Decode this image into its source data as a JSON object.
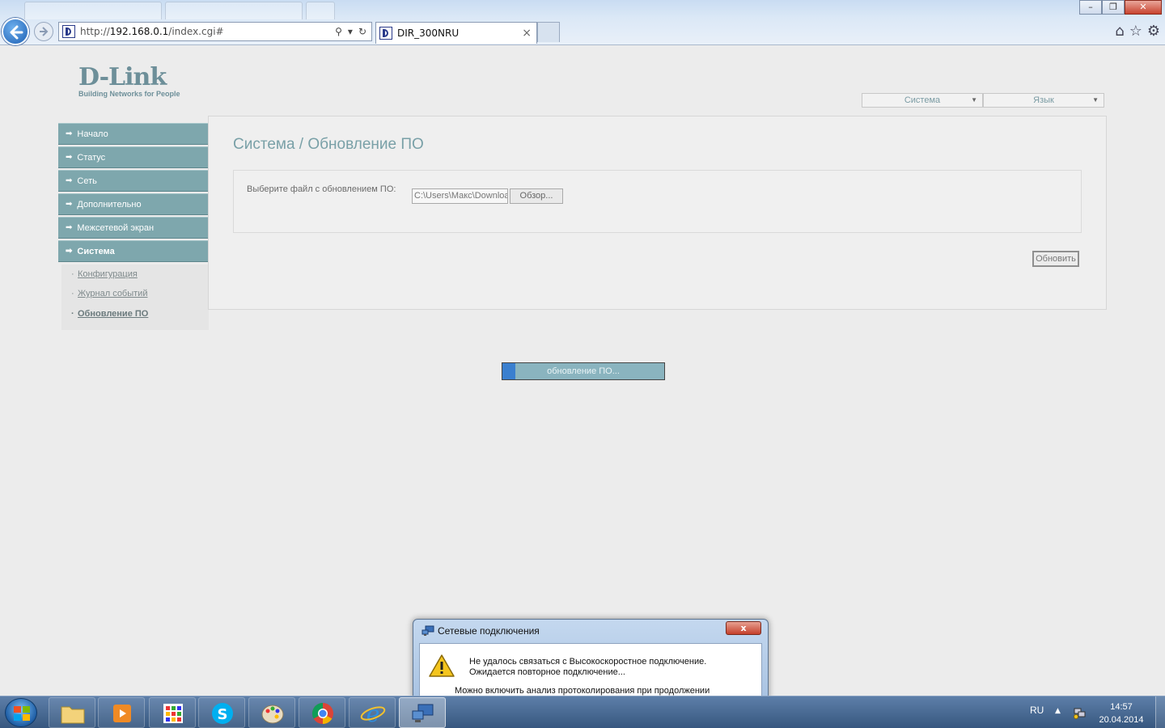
{
  "browser": {
    "url_prefix": "http://",
    "url_host": "192.168.0.1",
    "url_path": "/index.cgi#",
    "tab_title": "DIR_300NRU"
  },
  "logo": {
    "brand": "D-Link",
    "tagline": "Building Networks for People"
  },
  "top_menu": {
    "system": "Система",
    "language": "Язык"
  },
  "sidebar": {
    "items": [
      {
        "label": "Начало"
      },
      {
        "label": "Статус"
      },
      {
        "label": "Сеть"
      },
      {
        "label": "Дополнительно"
      },
      {
        "label": "Межсетевой экран"
      },
      {
        "label": "Система"
      }
    ],
    "sub_items": [
      {
        "label": "Конфигурация"
      },
      {
        "label": "Журнал событий"
      },
      {
        "label": "Обновление ПО"
      }
    ]
  },
  "main": {
    "title": "Система / Обновление ПО",
    "file_label": "Выберите файл с обновлением ПО:",
    "file_value": "C:\\Users\\Макс\\Downloa",
    "browse_label": "Обзор...",
    "update_label": "Обновить"
  },
  "progress": {
    "text": "обновление ПО...",
    "fraction": 0.08
  },
  "dialog": {
    "title": "Сетевые подключения",
    "close_label": "x",
    "message_line1": "Не удалось связаться с Высокоскоростное подключение.",
    "message_line2": "Ожидается повторное подключение...",
    "hint": "Можно включить анализ протоколирования при продолжении"
  },
  "taskbar": {
    "language": "RU",
    "time": "14:57",
    "date": "20.04.2014"
  },
  "colors": {
    "sidebar": "#7ea7ad",
    "title": "#79a0a7",
    "progress_fill": "#3a7fcf"
  }
}
